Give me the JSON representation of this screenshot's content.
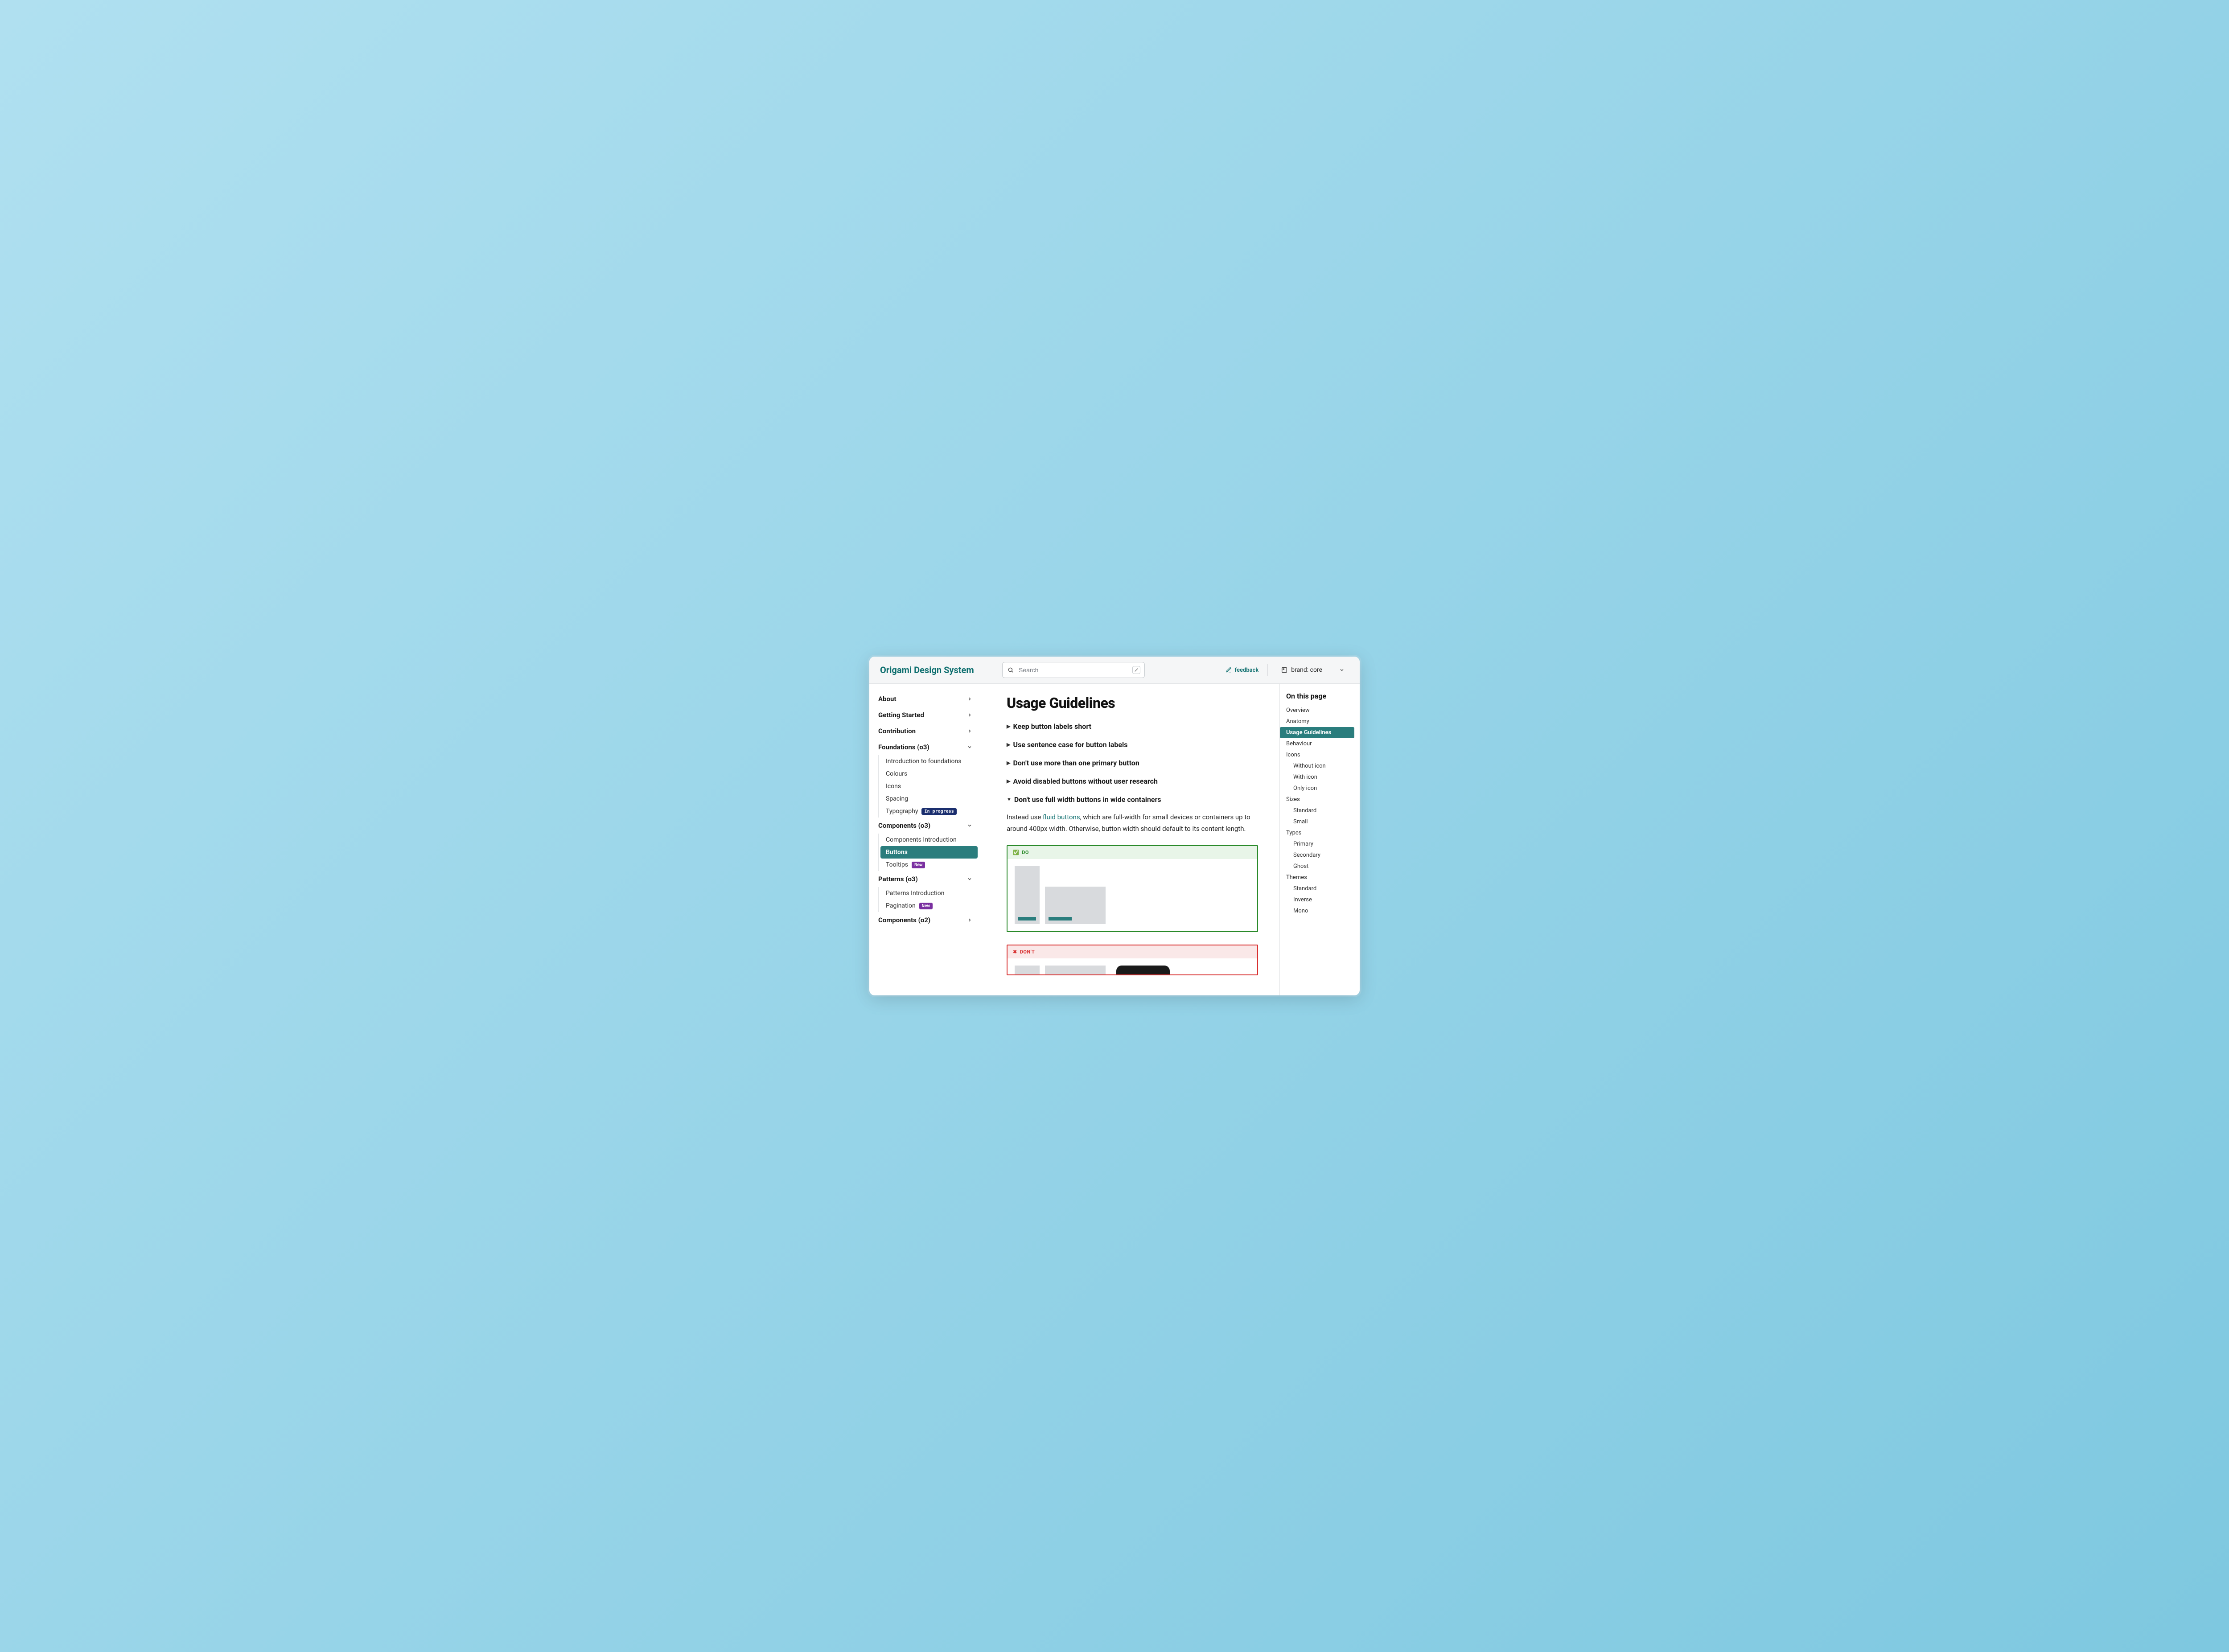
{
  "header": {
    "logo": "Origami Design System",
    "search_placeholder": "Search",
    "feedback_label": "feedback",
    "brand_label": "brand: core"
  },
  "sidebar": {
    "sections": [
      {
        "label": "About",
        "expanded": false
      },
      {
        "label": "Getting Started",
        "expanded": false
      },
      {
        "label": "Contribution",
        "expanded": false
      },
      {
        "label": "Foundations (o3)",
        "expanded": true,
        "items": [
          {
            "label": "Introduction to foundations"
          },
          {
            "label": "Colours"
          },
          {
            "label": "Icons"
          },
          {
            "label": "Spacing"
          },
          {
            "label": "Typography",
            "badge": "In progress",
            "badge_style": "blue"
          }
        ]
      },
      {
        "label": "Components (o3)",
        "expanded": true,
        "items": [
          {
            "label": "Components Introduction"
          },
          {
            "label": "Buttons",
            "active": true
          },
          {
            "label": "Tooltips",
            "badge": "New",
            "badge_style": "purple"
          }
        ]
      },
      {
        "label": "Patterns (o3)",
        "expanded": true,
        "items": [
          {
            "label": "Patterns Introduction"
          },
          {
            "label": "Pagination",
            "badge": "New",
            "badge_style": "purple"
          }
        ]
      },
      {
        "label": "Components (o2)",
        "expanded": false
      }
    ]
  },
  "main": {
    "title": "Usage Guidelines",
    "guidelines": [
      {
        "summary": "Keep button labels short",
        "open": false
      },
      {
        "summary": "Use sentence case for button labels",
        "open": false
      },
      {
        "summary": "Don't use more than one primary button",
        "open": false
      },
      {
        "summary": "Avoid disabled buttons without user research",
        "open": false
      },
      {
        "summary": "Don't use full width buttons in wide containers",
        "open": true,
        "body_prefix": "Instead use ",
        "body_link": "fluid buttons",
        "body_suffix": ", which are full-width for small devices or containers up to around 400px width. Otherwise, button width should default to its content length."
      }
    ],
    "do_label": "DO",
    "dont_label": "DON'T"
  },
  "toc": {
    "heading": "On this page",
    "items": [
      {
        "label": "Overview",
        "level": 1
      },
      {
        "label": "Anatomy",
        "level": 1
      },
      {
        "label": "Usage Guidelines",
        "level": 1,
        "active": true
      },
      {
        "label": "Behaviour",
        "level": 1
      },
      {
        "label": "Icons",
        "level": 1
      },
      {
        "label": "Without icon",
        "level": 2
      },
      {
        "label": "With icon",
        "level": 2
      },
      {
        "label": "Only icon",
        "level": 2
      },
      {
        "label": "Sizes",
        "level": 1
      },
      {
        "label": "Standard",
        "level": 2
      },
      {
        "label": "Small",
        "level": 2
      },
      {
        "label": "Types",
        "level": 1
      },
      {
        "label": "Primary",
        "level": 2
      },
      {
        "label": "Secondary",
        "level": 2
      },
      {
        "label": "Ghost",
        "level": 2
      },
      {
        "label": "Themes",
        "level": 1
      },
      {
        "label": "Standard",
        "level": 2
      },
      {
        "label": "Inverse",
        "level": 2
      },
      {
        "label": "Mono",
        "level": 2
      }
    ]
  }
}
